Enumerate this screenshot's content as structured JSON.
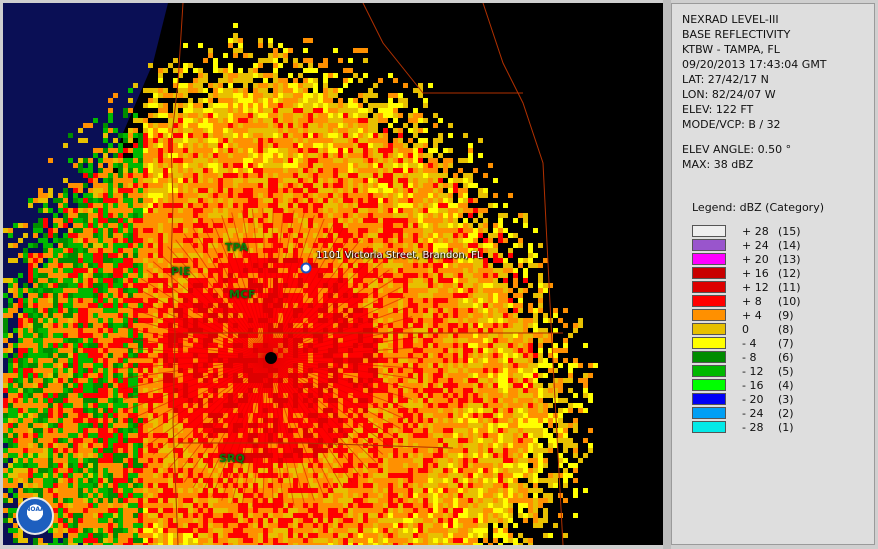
{
  "panel": {
    "lines": [
      "NEXRAD LEVEL-III",
      "BASE REFLECTIVITY",
      "KTBW - TAMPA, FL",
      "09/20/2013 17:43:04 GMT",
      "LAT: 27/42/17 N",
      "LON: 82/24/07 W",
      "ELEV: 122 FT",
      "MODE/VCP: B / 32"
    ],
    "elev_angle": "ELEV ANGLE: 0.50 °",
    "max": "MAX: 38 dBZ",
    "legend_title": "Legend: dBZ (Category)",
    "legend": [
      {
        "value": "+ 28",
        "category": "(15)",
        "color": "#eeeeee"
      },
      {
        "value": "+ 24",
        "category": "(14)",
        "color": "#9955cc"
      },
      {
        "value": "+ 20",
        "category": "(13)",
        "color": "#ff00ff"
      },
      {
        "value": "+ 16",
        "category": "(12)",
        "color": "#c80000"
      },
      {
        "value": "+ 12",
        "category": "(11)",
        "color": "#dd0000"
      },
      {
        "value": "+ 8",
        "category": "(10)",
        "color": "#ff0000"
      },
      {
        "value": "+ 4",
        "category": "(9)",
        "color": "#ff9000"
      },
      {
        "value": "0",
        "category": "(8)",
        "color": "#e7c000"
      },
      {
        "value": "- 4",
        "category": "(7)",
        "color": "#ffff00"
      },
      {
        "value": "- 8",
        "category": "(6)",
        "color": "#008c00"
      },
      {
        "value": "- 12",
        "category": "(5)",
        "color": "#00b800"
      },
      {
        "value": "- 16",
        "category": "(4)",
        "color": "#00ff00"
      },
      {
        "value": "- 20",
        "category": "(3)",
        "color": "#0000f6"
      },
      {
        "value": "- 24",
        "category": "(2)",
        "color": "#019ff4"
      },
      {
        "value": "- 28",
        "category": "(1)",
        "color": "#04e9e7"
      }
    ]
  },
  "map": {
    "airports": [
      "TPA",
      "PIE",
      "MCF",
      "SRQ"
    ],
    "address_label": "1101 Victoria Street, Brandon, FL",
    "logo": "NOAA",
    "icons": {
      "radar_site": "radar-site-icon",
      "address_marker": "location-marker-icon",
      "logo": "noaa-logo-icon"
    },
    "colors": {
      "water": "#0a0f55",
      "land": "#000000"
    }
  }
}
